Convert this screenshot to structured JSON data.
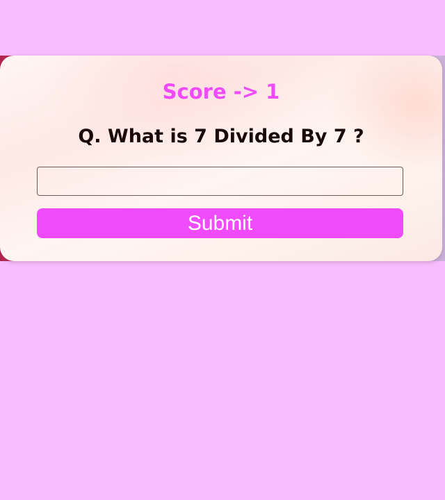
{
  "quiz": {
    "score_text": "Score -> 1",
    "question_text": "Q. What is 7 Divided By 7 ?",
    "answer_value": "",
    "answer_placeholder": "",
    "submit_label": "Submit"
  },
  "colors": {
    "page_background": "#f7bcfd",
    "accent": "#ef4bfa",
    "question_text": "#1a0a0a",
    "button_text": "#ffffff"
  }
}
